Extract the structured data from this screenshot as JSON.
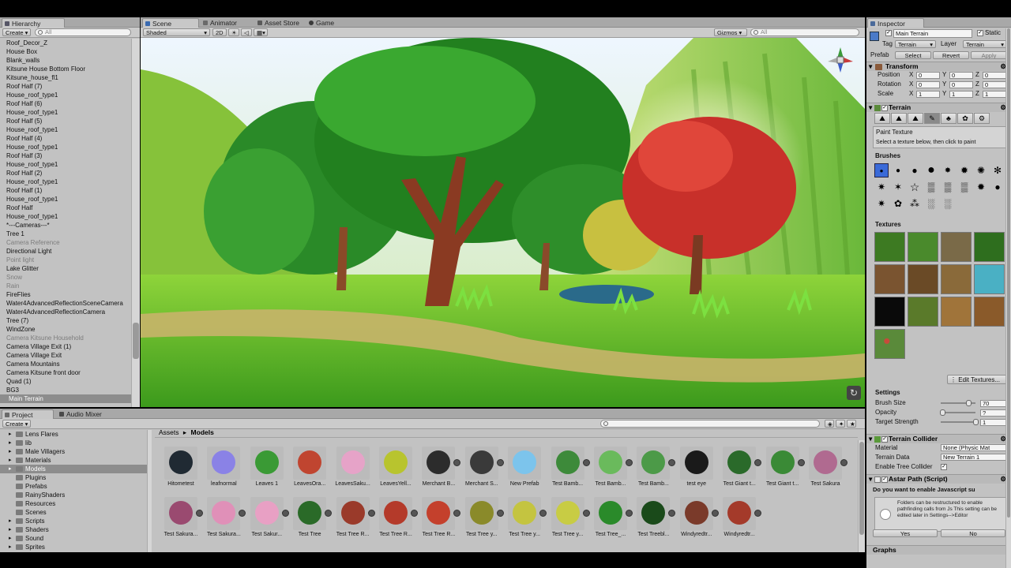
{
  "hierarchy": {
    "tab": "Hierarchy",
    "create": "Create",
    "search_placeholder": "All",
    "items": [
      {
        "label": "Roof_Decor_Z",
        "gray": false
      },
      {
        "label": "House Box",
        "gray": false
      },
      {
        "label": "Blank_walls",
        "gray": false
      },
      {
        "label": "Kitsune House Bottom Floor",
        "gray": false
      },
      {
        "label": "Kitsune_house_fl1",
        "gray": false
      },
      {
        "label": "Roof Half (7)",
        "gray": false
      },
      {
        "label": "House_roof_type1",
        "gray": false
      },
      {
        "label": "Roof Half (6)",
        "gray": false
      },
      {
        "label": "House_roof_type1",
        "gray": false
      },
      {
        "label": "Roof Half (5)",
        "gray": false
      },
      {
        "label": "House_roof_type1",
        "gray": false
      },
      {
        "label": "Roof Half (4)",
        "gray": false
      },
      {
        "label": "House_roof_type1",
        "gray": false
      },
      {
        "label": "Roof Half (3)",
        "gray": false
      },
      {
        "label": "House_roof_type1",
        "gray": false
      },
      {
        "label": "Roof Half (2)",
        "gray": false
      },
      {
        "label": "House_roof_type1",
        "gray": false
      },
      {
        "label": "Roof Half (1)",
        "gray": false
      },
      {
        "label": "House_roof_type1",
        "gray": false
      },
      {
        "label": "Roof Half",
        "gray": false
      },
      {
        "label": "House_roof_type1",
        "gray": false
      },
      {
        "label": "*---Cameras---*",
        "gray": false
      },
      {
        "label": "Tree 1",
        "gray": false
      },
      {
        "label": "Camera Reference",
        "gray": true
      },
      {
        "label": "Directional Light",
        "gray": false
      },
      {
        "label": "Point light",
        "gray": true
      },
      {
        "label": "Lake Glitter",
        "gray": false
      },
      {
        "label": "Snow",
        "gray": true
      },
      {
        "label": "Rain",
        "gray": true
      },
      {
        "label": "FireFlies",
        "gray": false
      },
      {
        "label": "Water4AdvancedReflectionSceneCamera",
        "gray": false
      },
      {
        "label": "Water4AdvancedReflectionCamera",
        "gray": false
      },
      {
        "label": "Tree (7)",
        "gray": false
      },
      {
        "label": "WindZone",
        "gray": false
      },
      {
        "label": "Camera Kitsune Household",
        "gray": true
      },
      {
        "label": "Camera Village Exit (1)",
        "gray": false
      },
      {
        "label": "Camera Village Exit",
        "gray": false
      },
      {
        "label": "Camera Mountains",
        "gray": false
      },
      {
        "label": "Camera Kitsune front door",
        "gray": false
      },
      {
        "label": "Quad (1)",
        "gray": false
      },
      {
        "label": "BG3",
        "gray": false
      }
    ],
    "selected": "Main Terrain"
  },
  "scene": {
    "tabs": [
      "Scene",
      "Animator",
      "Asset Store",
      "Game"
    ],
    "shading": "Shaded",
    "mode_2d": "2D",
    "gizmos": "Gizmos",
    "search_placeholder": "All"
  },
  "project": {
    "tabs": [
      "Project",
      "Audio Mixer"
    ],
    "create": "Create",
    "folders": [
      "Lens Flares",
      "lib",
      "Male Villagers",
      "Materials",
      "Models",
      "Plugins",
      "Prefabs",
      "RainyShaders",
      "Resources",
      "Scenes",
      "Scripts",
      "Shaders",
      "Sound",
      "Sprites"
    ],
    "selected_folder": "Models",
    "breadcrumb_root": "Assets",
    "breadcrumb_current": "Models",
    "assets_row1": [
      {
        "label": "Hitometest",
        "color": "#202a33"
      },
      {
        "label": "leafnormal",
        "color": "#8a82e6"
      },
      {
        "label": "Leaves 1",
        "color": "#3a9a35"
      },
      {
        "label": "LeavesOra...",
        "color": "#c04530"
      },
      {
        "label": "LeavesSaku...",
        "color": "#e6a3c8"
      },
      {
        "label": "LeavesYell...",
        "color": "#b8c42e"
      },
      {
        "label": "Merchant B...",
        "color": "#2c2c2c"
      },
      {
        "label": "Merchant S...",
        "color": "#3a3a3a"
      },
      {
        "label": "New Prefab",
        "color": "#7cc4ec"
      },
      {
        "label": "Test Bamb...",
        "color": "#3d8a3a"
      },
      {
        "label": "Test Bamb...",
        "color": "#6aba5c"
      },
      {
        "label": "Test Bamb...",
        "color": "#4c9a48"
      },
      {
        "label": "test eye",
        "color": "#1a1a1a"
      },
      {
        "label": "Test Giant t...",
        "color": "#2a6a2a"
      },
      {
        "label": "Test Giant t...",
        "color": "#3a8a36"
      },
      {
        "label": "Test Sakura",
        "color": "#b06a90"
      }
    ],
    "assets_row2": [
      {
        "label": "Test Sakura...",
        "color": "#9a4a70"
      },
      {
        "label": "Test Sakura...",
        "color": "#e090b8"
      },
      {
        "label": "Test Sakur...",
        "color": "#e8a0c4"
      },
      {
        "label": "Test Tree",
        "color": "#2a6a28"
      },
      {
        "label": "Test Tree R...",
        "color": "#9a3a2a"
      },
      {
        "label": "Test Tree R...",
        "color": "#b43a2a"
      },
      {
        "label": "Test Tree R...",
        "color": "#c4402c"
      },
      {
        "label": "Test Tree y...",
        "color": "#8a8a2a"
      },
      {
        "label": "Test Tree y...",
        "color": "#c4c440"
      },
      {
        "label": "Test Tree y...",
        "color": "#c8cc44"
      },
      {
        "label": "Test Tree_...",
        "color": "#2a8a2a"
      },
      {
        "label": "Test Treebl...",
        "color": "#1a4a1a"
      },
      {
        "label": "Windyredtr...",
        "color": "#7a3a2a"
      },
      {
        "label": "Windyredtr...",
        "color": "#a43a2a"
      }
    ]
  },
  "inspector": {
    "tab": "Inspector",
    "object_name": "Main Terrain",
    "static_label": "Static",
    "static_checked": true,
    "tag_label": "Tag",
    "tag_value": "Terrain",
    "layer_label": "Layer",
    "layer_value": "Terrain",
    "prefab_label": "Prefab",
    "prefab_select": "Select",
    "prefab_revert": "Revert",
    "prefab_apply": "Apply",
    "transform": {
      "title": "Transform",
      "rows": [
        {
          "label": "Position",
          "x": "0",
          "y": "0",
          "z": "0"
        },
        {
          "label": "Rotation",
          "x": "0",
          "y": "0",
          "z": "0"
        },
        {
          "label": "Scale",
          "x": "1",
          "y": "1",
          "z": "1"
        }
      ],
      "x": "X",
      "y": "Y",
      "z": "Z"
    },
    "terrain": {
      "title": "Terrain",
      "tool_title": "Paint Texture",
      "tool_hint": "Select a texture below, then click to paint",
      "brushes_label": "Brushes",
      "textures_label": "Textures",
      "edit_textures": "Edit Textures...",
      "settings_label": "Settings",
      "brush_size_label": "Brush Size",
      "brush_size_value": "70",
      "brush_size_fraction": 0.8,
      "opacity_label": "Opacity",
      "opacity_value": "?",
      "opacity_fraction": 0.05,
      "target_strength_label": "Target Strength",
      "target_strength_value": "1",
      "target_strength_fraction": 1.0,
      "textures": [
        "#3d7a22",
        "#4a8a2c",
        "#7a6a48",
        "#2e6e1e",
        "#7a5430",
        "#6a4a26",
        "#8a6a3a",
        "#4ab0c4",
        "#0a0a0a",
        "#5a7a2a",
        "#a0743a",
        "#8a5a2a",
        "#5a8a3a"
      ]
    },
    "collider": {
      "title": "Terrain Collider",
      "material_label": "Material",
      "material_value": "None (Physic Mat",
      "data_label": "Terrain Data",
      "data_value": "New Terrain 1",
      "tree_label": "Enable Tree Collider",
      "tree_checked": true
    },
    "astar": {
      "title": "Astar Path (Script)",
      "dialog_title": "Do you want to enable Javascript su",
      "dialog_text": "Folders can be restructured to enable pathfinding calls from Js This setting can be edited later in Settings-->Editor",
      "yes": "Yes",
      "no": "No"
    },
    "graphs_label": "Graphs"
  }
}
